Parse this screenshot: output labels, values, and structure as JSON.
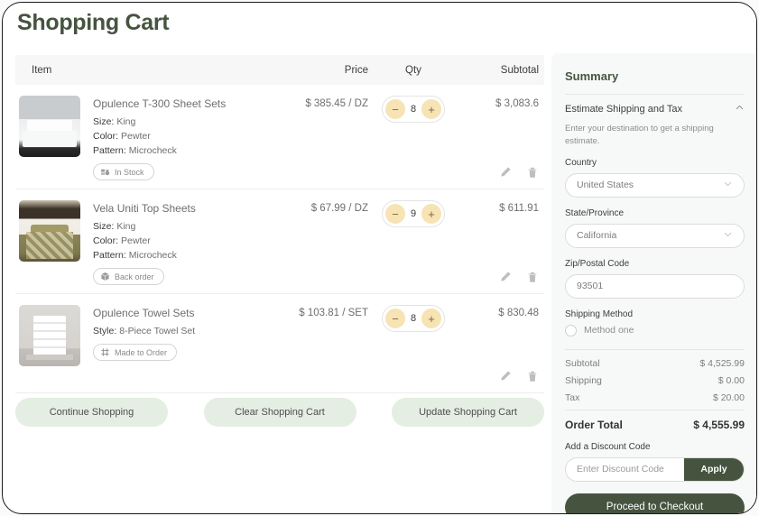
{
  "page": {
    "title": "Shopping Cart"
  },
  "table": {
    "headers": {
      "item": "Item",
      "price": "Price",
      "qty": "Qty",
      "subtotal": "Subtotal"
    }
  },
  "items": [
    {
      "name": "Opulence T-300 Sheet Sets",
      "attrs": [
        {
          "key": "Size:",
          "value": "King"
        },
        {
          "key": "Color:",
          "value": "Pewter"
        },
        {
          "key": "Pattern:",
          "value": "Microcheck"
        }
      ],
      "badge": {
        "label": "In Stock",
        "icon": "inventory-box-icon"
      },
      "price": "$ 385.45 / DZ",
      "qty": "8",
      "subtotal": "$ 3,083.6",
      "image": "white-sheets-on-bed"
    },
    {
      "name": "Vela Uniti Top Sheets",
      "attrs": [
        {
          "key": "Size:",
          "value": "King"
        },
        {
          "key": "Color:",
          "value": "Pewter"
        },
        {
          "key": "Pattern:",
          "value": "Microcheck"
        }
      ],
      "badge": {
        "label": "Back order",
        "icon": "package-box-icon"
      },
      "price": "$ 67.99 / DZ",
      "qty": "9",
      "subtotal": "$ 611.91",
      "image": "bed-with-olive-patterned-cover"
    },
    {
      "name": "Opulence Towel Sets",
      "attrs": [
        {
          "key": "Style:",
          "value": "8-Piece Towel Set"
        }
      ],
      "badge": {
        "label": "Made to Order",
        "icon": "grid-hash-icon"
      },
      "price": "$ 103.81 / SET",
      "qty": "8",
      "subtotal": "$ 830.48",
      "image": "stacked-white-towels"
    }
  ],
  "stepper": {
    "minus": "−",
    "plus": "+"
  },
  "actions": {
    "continue": "Continue Shopping",
    "clear": "Clear Shopping Cart",
    "update": "Update Shopping Cart"
  },
  "summary": {
    "title": "Summary",
    "estimate_heading": "Estimate Shipping and Tax",
    "estimate_note": "Enter your destination to get a shipping estimate.",
    "country_label": "Country",
    "country_value": "United States",
    "state_label": "State/Province",
    "state_value": "California",
    "zip_label": "Zip/Postal Code",
    "zip_value": "93501",
    "shipping_method_label": "Shipping Method",
    "shipping_method_option": "Method one",
    "totals": [
      {
        "label": "Subtotal",
        "value": "$ 4,525.99"
      },
      {
        "label": "Shipping",
        "value": "$ 0.00"
      },
      {
        "label": "Tax",
        "value": "$ 20.00"
      }
    ],
    "order_total_label": "Order Total",
    "order_total_value": "$ 4,555.99",
    "discount_label": "Add a Discount Code",
    "discount_placeholder": "Enter Discount Code",
    "apply_label": "Apply",
    "checkout_label": "Proceed to Checkout"
  },
  "colors": {
    "brand_green": "#46543f",
    "pill_green": "#e4eee2",
    "stepper_yellow": "#f7e3b4",
    "panel_bg": "#f7f9f8"
  }
}
